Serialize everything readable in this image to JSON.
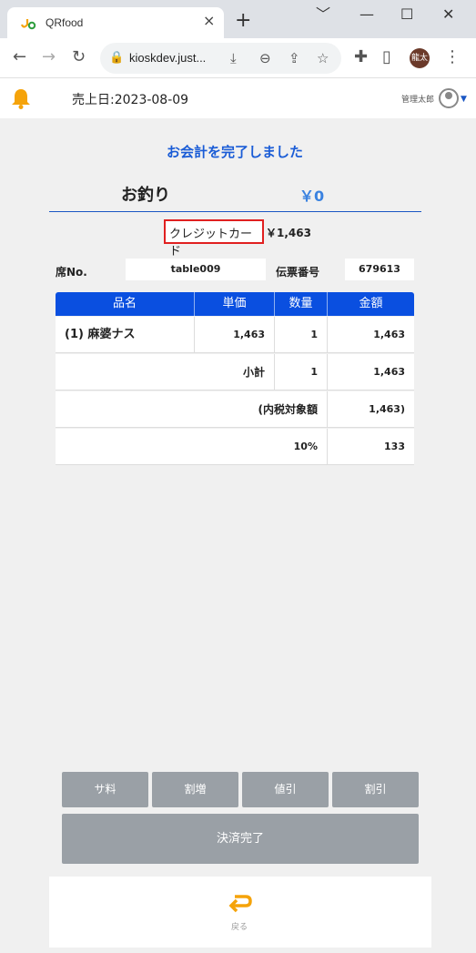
{
  "browser": {
    "tab_title": "QRfood",
    "tab_close": "×",
    "new_tab": "+",
    "url": "kioskdev.just...",
    "profile_initials": "龍太",
    "window_controls": [
      "﹀",
      "—",
      "☐",
      "✕"
    ]
  },
  "header": {
    "date_label": "売上日:2023-08-09",
    "admin_name": "管理太郎"
  },
  "main": {
    "complete_message": "お会計を完了しました",
    "change_label": "お釣り",
    "change_amount": "￥0",
    "payment_method": "クレジットカード",
    "payment_amount": "￥1,463",
    "seat_label": "席No.",
    "seat_value": "table009",
    "slip_label": "伝票番号",
    "slip_value": "679613"
  },
  "table": {
    "headers": [
      "品名",
      "単価",
      "数量",
      "金額"
    ],
    "item": {
      "name": "(1) 麻婆ナス",
      "unit_price": "1,463",
      "qty": "1",
      "amount": "1,463"
    },
    "subtotal": {
      "label": "小計",
      "qty": "1",
      "amount": "1,463"
    },
    "taxable": {
      "label": "(内税対象額",
      "amount": "1,463)"
    },
    "tax": {
      "label": "10%",
      "amount": "133"
    }
  },
  "actions": {
    "buttons": [
      "サ料",
      "割増",
      "値引",
      "割引"
    ],
    "complete": "決済完了",
    "back": "戻る"
  },
  "colors": {
    "accent_blue": "#1a5cd6",
    "header_blue": "#0a4fe0",
    "bell_orange": "#f5a30a",
    "button_grey": "#9aa0a6",
    "highlight_red": "#e02020"
  }
}
